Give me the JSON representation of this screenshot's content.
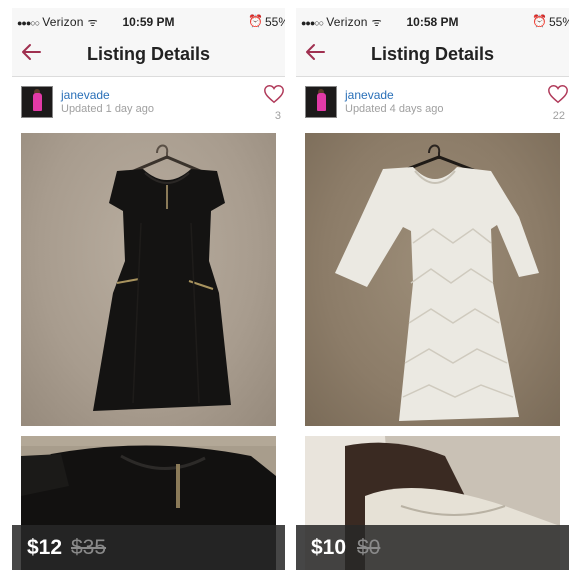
{
  "screens": [
    {
      "status": {
        "carrier": "Verizon",
        "time": "10:59 PM",
        "battery": "55%"
      },
      "nav": {
        "title": "Listing Details"
      },
      "seller": {
        "username": "janevade",
        "updated": "Updated 1 day ago",
        "likes": "3"
      },
      "listing": {
        "price": "$12",
        "original_price": "$35",
        "item": "black dress"
      }
    },
    {
      "status": {
        "carrier": "Verizon",
        "time": "10:58 PM",
        "battery": "55%"
      },
      "nav": {
        "title": "Listing Details"
      },
      "seller": {
        "username": "janevade",
        "updated": "Updated 4 days ago",
        "likes": "22"
      },
      "listing": {
        "price": "$10",
        "original_price": "$0",
        "item": "white lace dress"
      }
    }
  ],
  "icons": {
    "back": "back-arrow-icon",
    "like": "heart-icon",
    "wifi": "wifi-icon",
    "alarm": "alarm-clock-icon"
  },
  "colors": {
    "accent": "#a03050",
    "username": "#2a70b8",
    "muted": "#a0a0a0",
    "price_bar": "#2a2a2a"
  }
}
